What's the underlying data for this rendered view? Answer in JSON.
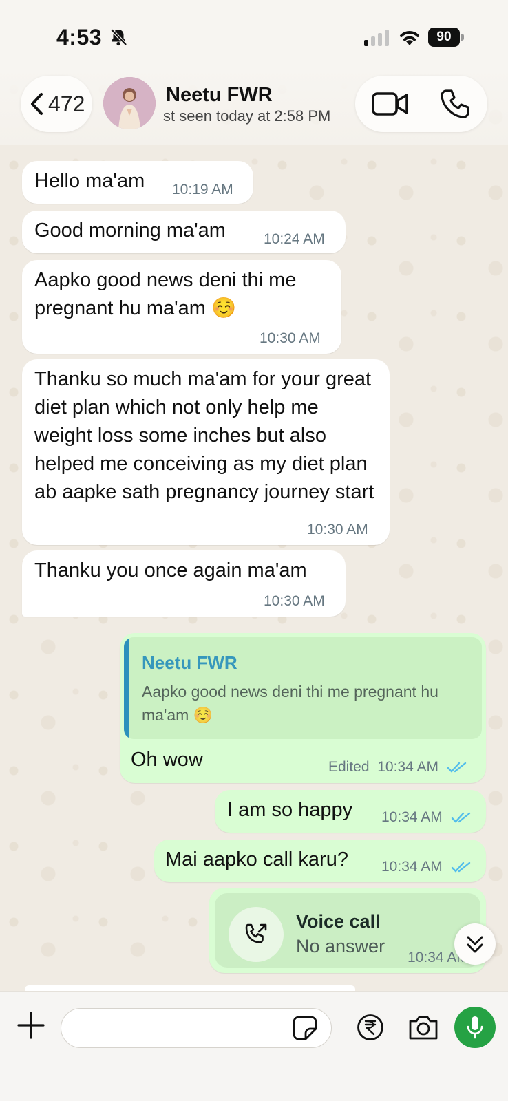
{
  "status_bar": {
    "time": "4:53",
    "battery": "90"
  },
  "header": {
    "back_count": "472",
    "contact_name": "Neetu FWR",
    "contact_status": "st seen today at 2:58 PM"
  },
  "messages": [
    {
      "direction": "in",
      "text": "Hello ma'am",
      "time": "10:19 AM"
    },
    {
      "direction": "in",
      "text": "Good morning ma'am",
      "time": "10:24 AM"
    },
    {
      "direction": "in",
      "text": "Aapko good news deni thi me pregnant hu ma'am ☺️",
      "time": "10:30 AM"
    },
    {
      "direction": "in",
      "text": "Thanku so much ma'am for your great diet plan which not only help me weight loss some inches but also helped me conceiving as my diet plan ab aapke sath pregnancy journey start",
      "time": "10:30 AM"
    },
    {
      "direction": "in",
      "text": "Thanku you once again ma'am",
      "time": "10:30 AM"
    },
    {
      "direction": "out",
      "quote": {
        "name": "Neetu FWR",
        "text": "Aapko good news deni thi me pregnant hu ma'am ☺️"
      },
      "text": "Oh wow",
      "edited": "Edited",
      "time": "10:34 AM"
    },
    {
      "direction": "out",
      "text": "I am so happy",
      "time": "10:34 AM"
    },
    {
      "direction": "out",
      "text": "Mai aapko call karu?",
      "time": "10:34 AM"
    },
    {
      "direction": "out",
      "call": {
        "title": "Voice call",
        "status": "No answer"
      },
      "time": "10:34 AM"
    }
  ],
  "composer": {
    "value": "",
    "placeholder": ""
  },
  "colors": {
    "incoming_bubble": "#ffffff",
    "outgoing_bubble": "#d9fdd3",
    "read_ticks": "#53bdeb",
    "quote_accent": "#0d7fb8",
    "mic_button": "#25a244"
  },
  "icons": [
    "bell-off-icon",
    "signal-icon",
    "wifi-icon",
    "battery-icon",
    "chevron-left-icon",
    "video-call-icon",
    "phone-icon",
    "double-check-icon",
    "outgoing-call-icon",
    "chevron-double-down-icon",
    "plus-icon",
    "sticker-icon",
    "rupee-icon",
    "camera-icon",
    "microphone-icon"
  ]
}
